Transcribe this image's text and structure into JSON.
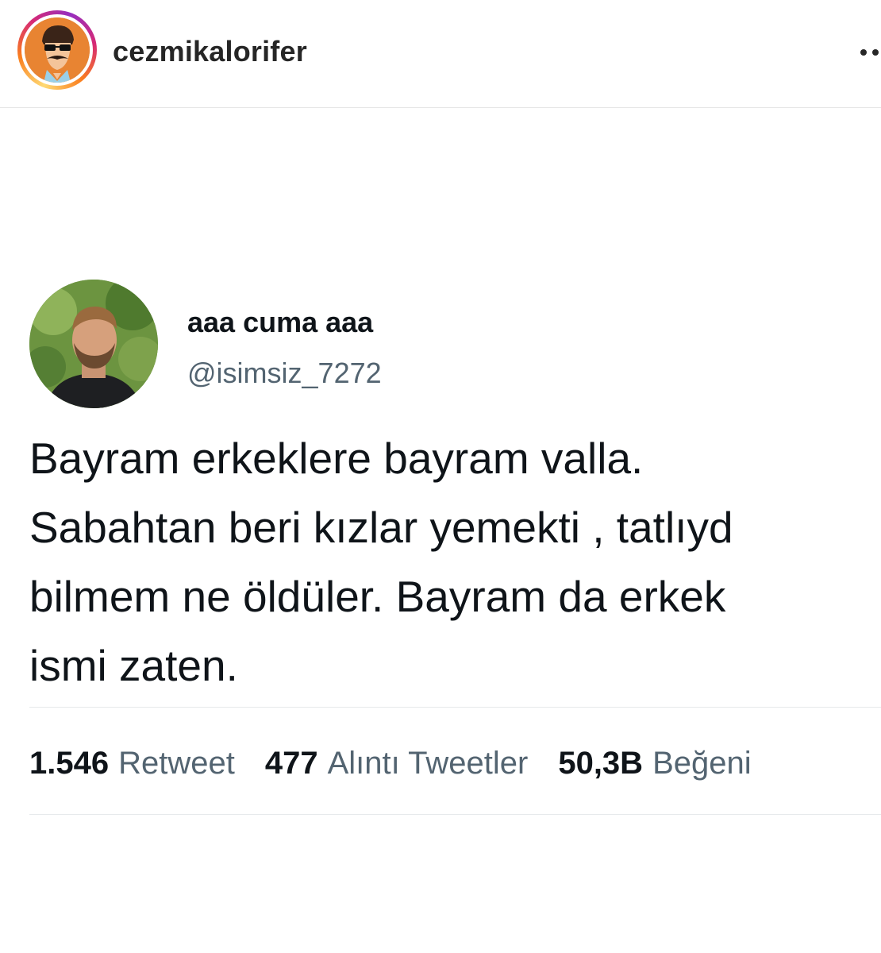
{
  "instagram_post": {
    "username": "cezmikalorifer",
    "avatar_icon": "cartoon-man-sunglasses-avatar",
    "more_icon": "more-options-icon"
  },
  "tweet": {
    "display_name": "aaa cuma aaa",
    "handle": "@isimsiz_7272",
    "avatar_icon": "profile-photo-man-beard",
    "text_lines": [
      "Bayram erkeklere bayram valla.",
      "Sabahtan beri kızlar yemekti , tatlıyd",
      "bilmem ne öldüler. Bayram da erkek",
      "ismi zaten."
    ],
    "stats": {
      "retweets": {
        "value": "1.546",
        "label": "Retweet"
      },
      "quotes": {
        "value": "477",
        "label": "Alıntı Tweetler"
      },
      "likes": {
        "value": "50,3B",
        "label": "Beğeni"
      }
    }
  },
  "colors": {
    "text_primary": "#0f1419",
    "text_secondary": "#536471",
    "divider": "#e6e9eb",
    "story_ring": [
      "#feda75",
      "#fa7e1e",
      "#d62976",
      "#962fbf"
    ]
  }
}
